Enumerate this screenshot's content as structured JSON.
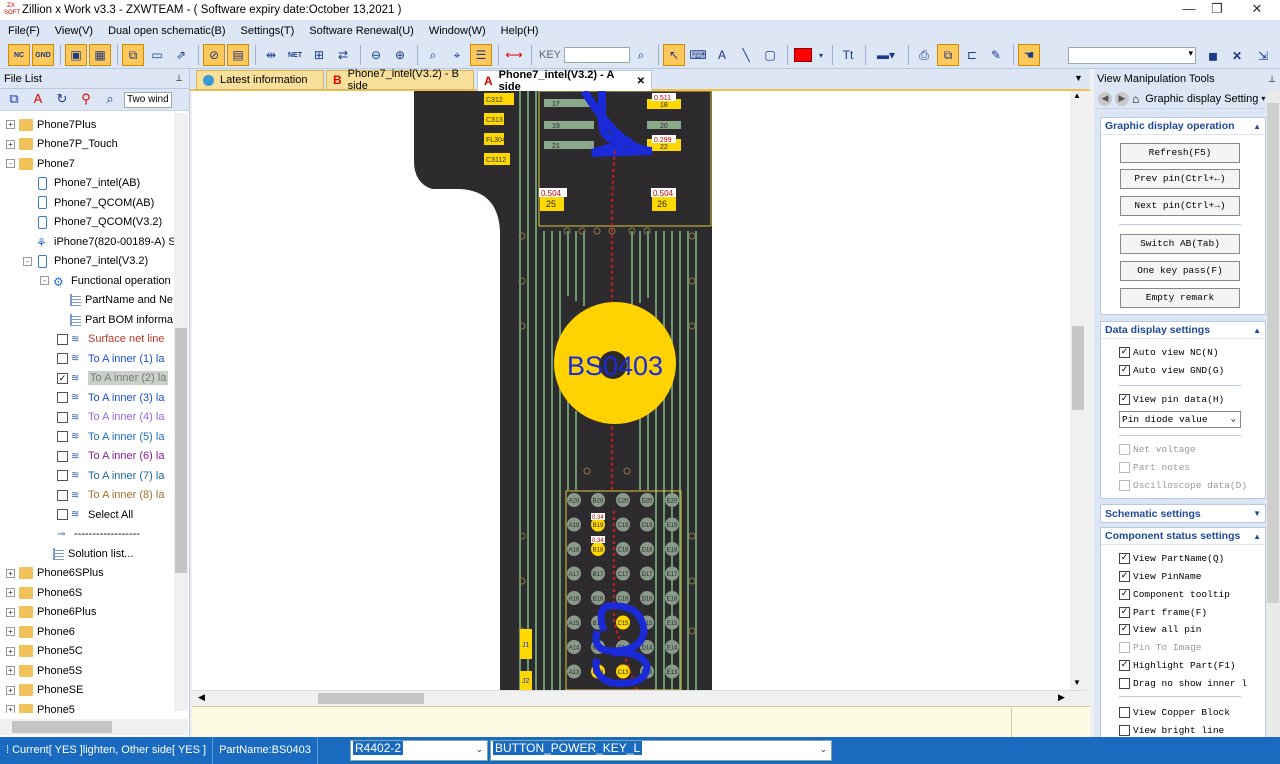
{
  "window": {
    "title": "Zillion x Work v3.3 - ZXWTEAM - ( Software expiry date:October 13,2021 )",
    "app_icon_text": "ZX SOFT",
    "minimize": "—",
    "maximize": "❐",
    "close": "✕"
  },
  "menu": [
    "File(F)",
    "View(V)",
    "Dual open schematic(B)",
    "Settings(T)",
    "Software Renewal(U)",
    "Window(W)",
    "Help(H)"
  ],
  "toolbar": {
    "nc_label": "NC",
    "gnd_label": "GND",
    "net_label": "NET",
    "key_label": "KEY",
    "key_value": "",
    "text_tool": "A",
    "tt_label": "Tt",
    "color": "#ff0000",
    "search_combo_value": ""
  },
  "left_panel": {
    "title": "File List",
    "pin": "📌",
    "search_value": "Two wind",
    "tree": [
      {
        "label": "Phone7Plus",
        "level": 0,
        "type": "folder",
        "expand": "+"
      },
      {
        "label": "Phone7P_Touch",
        "level": 0,
        "type": "folder",
        "expand": "+"
      },
      {
        "label": "Phone7",
        "level": 0,
        "type": "folder",
        "expand": "-"
      },
      {
        "label": "Phone7_intel(AB)",
        "level": 1,
        "type": "phone"
      },
      {
        "label": "Phone7_QCOM(AB)",
        "level": 1,
        "type": "phone"
      },
      {
        "label": "Phone7_QCOM(V3.2)",
        "level": 1,
        "type": "phone"
      },
      {
        "label": "iPhone7(820-00189-A) Sc",
        "level": 1,
        "type": "schematic"
      },
      {
        "label": "Phone7_intel(V3.2)",
        "level": 1,
        "type": "phone",
        "expand": "-"
      },
      {
        "label": "Functional operation",
        "level": 2,
        "type": "gear",
        "expand": "-"
      },
      {
        "label": "PartName and Ne",
        "level": 3,
        "type": "list"
      },
      {
        "label": "Part BOM informa",
        "level": 3,
        "type": "list"
      },
      {
        "label": "Surface net line",
        "level": 3,
        "type": "layer",
        "color": "#c0392b",
        "checked": false
      },
      {
        "label": "To A inner (1) la",
        "level": 3,
        "type": "layer",
        "color": "#1a4fd0",
        "checked": false
      },
      {
        "label": "To A inner (2) la",
        "level": 3,
        "type": "layer",
        "color": "#7a7a7a",
        "checked": true,
        "selected": true
      },
      {
        "label": "To A inner (3) la",
        "level": 3,
        "type": "layer",
        "color": "#1a4fd0",
        "checked": false
      },
      {
        "label": "To A inner (4) la",
        "level": 3,
        "type": "layer",
        "color": "#9a6adc",
        "checked": false
      },
      {
        "label": "To A inner (5) la",
        "level": 3,
        "type": "layer",
        "color": "#1a70c0",
        "checked": false
      },
      {
        "label": "To A inner (6) la",
        "level": 3,
        "type": "layer",
        "color": "#8a1a9a",
        "checked": false
      },
      {
        "label": "To A inner (7) la",
        "level": 3,
        "type": "layer",
        "color": "#1a6aa0",
        "checked": false
      },
      {
        "label": "To A inner (8) la",
        "level": 3,
        "type": "layer",
        "color": "#a0702a",
        "checked": false
      },
      {
        "label": "Select All",
        "level": 3,
        "type": "checkbox",
        "color": "#000000",
        "checked": false
      },
      {
        "label": "------------------",
        "level": 3,
        "type": "sep"
      },
      {
        "label": "Solution list...",
        "level": 2,
        "type": "list"
      },
      {
        "label": "Phone6SPlus",
        "level": 0,
        "type": "folder",
        "expand": "+"
      },
      {
        "label": "Phone6S",
        "level": 0,
        "type": "folder",
        "expand": "+"
      },
      {
        "label": "Phone6Plus",
        "level": 0,
        "type": "folder",
        "expand": "+"
      },
      {
        "label": "Phone6",
        "level": 0,
        "type": "folder",
        "expand": "+"
      },
      {
        "label": "Phone5C",
        "level": 0,
        "type": "folder",
        "expand": "+"
      },
      {
        "label": "Phone5S",
        "level": 0,
        "type": "folder",
        "expand": "+"
      },
      {
        "label": "PhoneSE",
        "level": 0,
        "type": "folder",
        "expand": "+"
      },
      {
        "label": "Phone5",
        "level": 0,
        "type": "folder",
        "expand": "+"
      }
    ]
  },
  "tabs": [
    {
      "label": "Latest information",
      "badge": ""
    },
    {
      "label": "Phone7_intel(V3.2) - B side",
      "badge": "B"
    },
    {
      "label": "Phone7_intel(V3.2) - A side",
      "badge": "A",
      "active": true,
      "close": "✕"
    }
  ],
  "tab_dropdown": "▼",
  "board": {
    "part_name": "BS0403",
    "top_labels": [
      "C312",
      "C313",
      "FL304",
      "C3112"
    ],
    "pin_numbers": [
      "17",
      "18",
      "19",
      "20",
      "21",
      "22",
      "25",
      "26"
    ],
    "pin_values": [
      "0.511",
      "0.299",
      "0.504",
      "0.504"
    ],
    "bga_rows": [
      [
        "A20",
        "B20",
        "C20",
        "D20",
        "E20"
      ],
      [
        "A19",
        "B19",
        "C19",
        "D19",
        "E19"
      ],
      [
        "A18",
        "B18",
        "C18",
        "D18",
        "E18"
      ],
      [
        "A17",
        "B17",
        "C17",
        "D17",
        "E17"
      ],
      [
        "A16",
        "B16",
        "C16",
        "D16",
        "E16"
      ],
      [
        "A15",
        "B15",
        "C15",
        "D15",
        "E15"
      ],
      [
        "A14",
        "B14",
        "C14",
        "D14",
        "E14"
      ],
      [
        "A13",
        "B13",
        "C13",
        "D13",
        "E13"
      ]
    ],
    "bga_values": [
      "0.34",
      "0.34"
    ],
    "side_labels": [
      "J1",
      "J2"
    ]
  },
  "right_panel": {
    "title": "View Manipulation Tools",
    "nav_label": "Graphic display Setting",
    "graphic_section": {
      "title": "Graphic display operation",
      "buttons": [
        "Refresh(F5)",
        "Prev pin(Ctrl+←)",
        "Next pin(Ctrl+→)",
        "Switch AB(Tab)",
        "One key pass(F)",
        "Empty remark"
      ]
    },
    "data_section": {
      "title": "Data display settings",
      "checks": [
        {
          "label": "Auto view NC(N)",
          "checked": true
        },
        {
          "label": "Auto view GND(G)",
          "checked": true
        },
        {
          "label": "View pin data(H)",
          "checked": true
        }
      ],
      "pin_select": "Pin diode value",
      "disabled_checks": [
        "Net voltage",
        "Part notes",
        "Oscilloscope data(D)"
      ]
    },
    "schematic_section": {
      "title": "Schematic settings"
    },
    "component_section": {
      "title": "Component status settings",
      "checks": [
        {
          "label": "View PartName(Q)",
          "checked": true,
          "disabled": false
        },
        {
          "label": "View PinName",
          "checked": true,
          "disabled": false
        },
        {
          "label": "Component tooltip",
          "checked": true,
          "disabled": false
        },
        {
          "label": "Part frame(F)",
          "checked": true,
          "disabled": false
        },
        {
          "label": "View all pin",
          "checked": true,
          "disabled": false
        },
        {
          "label": "Pin To Image",
          "checked": false,
          "disabled": true
        },
        {
          "label": "Highlight Part(F1)",
          "checked": true,
          "disabled": false
        },
        {
          "label": "Drag no show inner l",
          "checked": false,
          "disabled": false
        },
        {
          "label": "View Copper Block",
          "checked": false,
          "disabled": false
        },
        {
          "label": "View bright line",
          "checked": false,
          "disabled": false
        }
      ]
    }
  },
  "status": {
    "current": "Current[ YES ]lighten, Other side[ YES ]",
    "partname": "PartName:BS0403",
    "combo1": "R4402-2",
    "combo2": "BUTTON_POWER_KEY_L"
  }
}
